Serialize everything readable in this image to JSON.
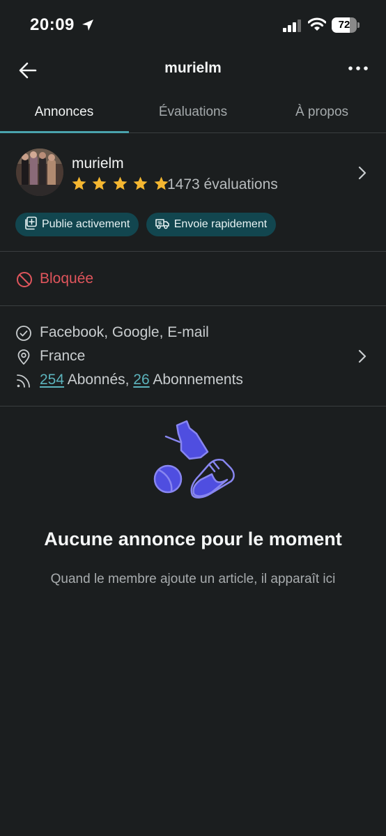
{
  "status_bar": {
    "time": "20:09",
    "battery_level": "72",
    "battery_percent": 72
  },
  "nav": {
    "title": "murielm"
  },
  "tabs": [
    {
      "label": "Annonces",
      "active": true
    },
    {
      "label": "Évaluations",
      "active": false
    },
    {
      "label": "À propos",
      "active": false
    }
  ],
  "profile": {
    "username": "murielm",
    "rating_stars": 5,
    "rating_count": "1473 évaluations",
    "badges": [
      {
        "label": "Publie activement",
        "icon": "add-listing-icon"
      },
      {
        "label": "Envoie rapidement",
        "icon": "shipping-truck-icon"
      }
    ]
  },
  "blocked": {
    "label": "Bloquée",
    "color": "#e0555c"
  },
  "info": {
    "verified": "Facebook, Google, E-mail",
    "location": "France",
    "followers_count": "254",
    "followers_label": " Abonnés, ",
    "following_count": "26",
    "following_label": " Abonnements"
  },
  "empty_state": {
    "title": "Aucune annonce pour le moment",
    "subtitle": "Quand le membre ajoute un article, il apparaît ici"
  },
  "colors": {
    "background": "#1b1e1f",
    "accent": "#4aa3ad",
    "star": "#f5b731",
    "badge_bg": "#12464f",
    "illustration": "#4f4ee0"
  }
}
